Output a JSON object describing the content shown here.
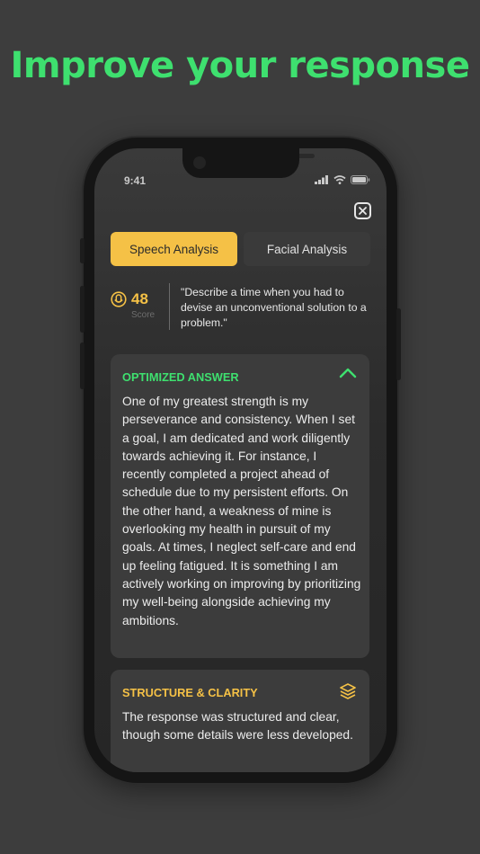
{
  "headline": "Improve your response",
  "status_bar": {
    "time": "9:41"
  },
  "tabs": [
    {
      "label": "Speech Analysis",
      "active": true
    },
    {
      "label": "Facial Analysis",
      "active": false
    }
  ],
  "score": {
    "value": "48",
    "label": "Score"
  },
  "question": "\"Describe a time when you had to devise an unconventional solution to a problem.\"",
  "cards": [
    {
      "title": "OPTIMIZED ANSWER",
      "icon": "chevron-up-icon",
      "text": "One of my greatest strength is my perseverance and consistency. When I set a goal, I am dedicated and work diligently towards achieving it. For instance, I recently completed a project ahead of schedule due to my persistent efforts. On the other hand, a weakness of mine is overlooking my health in pursuit of my goals. At times, I neglect self-care and end up feeling fatigued. It is something I am actively working on improving by prioritizing my well-being alongside achieving my ambitions."
    },
    {
      "title": "STRUCTURE & CLARITY",
      "icon": "layers-icon",
      "text": "The response was structured and clear, though some details were less developed."
    }
  ],
  "colors": {
    "accent_green": "#3ee06f",
    "accent_yellow": "#f5c146",
    "background": "#3d3d3d",
    "card": "#3c3c3c"
  }
}
